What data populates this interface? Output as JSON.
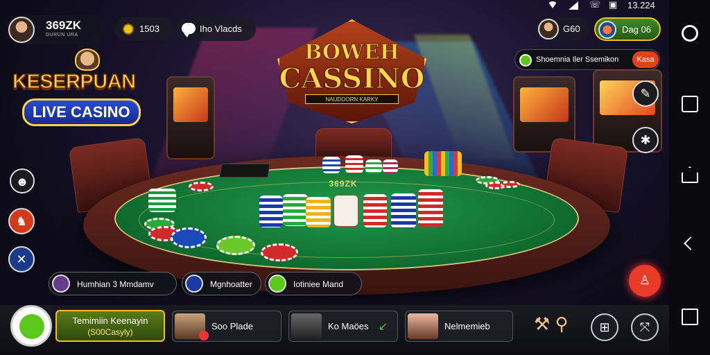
{
  "status": {
    "time": "13.224"
  },
  "profile": {
    "name": "369ZK",
    "subtitle": "DURUN URA"
  },
  "coins": {
    "value": "1503"
  },
  "chat": {
    "label": "Iho Vlacds"
  },
  "friend": {
    "label": "G60"
  },
  "daily": {
    "label": "Dag 06"
  },
  "logo_left": {
    "line1": "KESERPUAN",
    "line2": "LIVE CASINO"
  },
  "logo_main": {
    "line1": "BOWEH",
    "line2": "CASSINO",
    "tagline": "NAUDOORN KARKY"
  },
  "promo": {
    "text": "Shoemnia Iler Ssemikon",
    "button": "Kasa"
  },
  "table": {
    "brand": "369ZK"
  },
  "tags": [
    {
      "label": "Humhian 3 Mmdamv"
    },
    {
      "label": "Mgnhoatter"
    },
    {
      "label": "Iotiniee Mand"
    }
  ],
  "feature": {
    "line1": "Temimiin Keenayin",
    "line2": "(S00Casyly)"
  },
  "bottom_cards": [
    {
      "label": "Soo Plade"
    },
    {
      "label": "Ko Maöes"
    },
    {
      "label": "Nelmemieb"
    }
  ],
  "colors": {
    "accent_green": "#5ac81a",
    "accent_gold": "#f2c21a",
    "accent_red": "#ea3a2a",
    "felt": "#1f9a4a"
  }
}
